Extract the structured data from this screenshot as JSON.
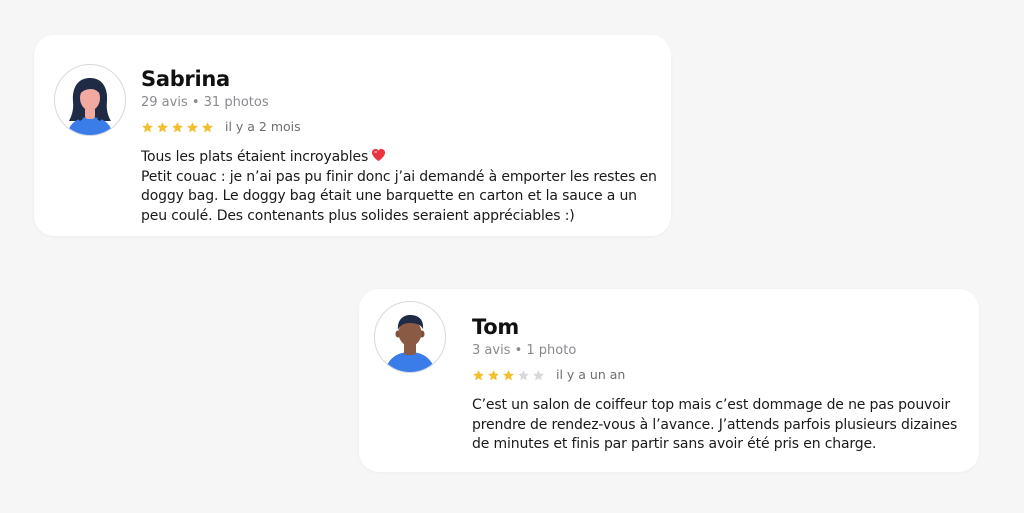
{
  "colors": {
    "star_filled": "#f4bf2e",
    "star_empty": "#d9d9dc",
    "avatar_shirt": "#3b7de8",
    "heart": "#e8353f"
  },
  "reviews": [
    {
      "name": "Sabrina",
      "meta": "29 avis • 31 photos",
      "rating": 5,
      "max_rating": 5,
      "date": "il y a 2 mois",
      "avatar_icon": "woman-avatar-icon",
      "lines": [
        "Tous les plats étaient incroyables",
        "Petit couac : je n’ai pas pu finir donc j’ai demandé à emporter les restes en",
        "doggy bag. Le doggy bag était une barquette en carton et la sauce a un",
        "peu coulé. Des contenants plus solides seraient appréciables :)"
      ]
    },
    {
      "name": "Tom",
      "meta": "3 avis • 1 photo",
      "rating": 3,
      "max_rating": 5,
      "date": "il y a un an",
      "avatar_icon": "man-avatar-icon",
      "lines": [
        "C’est un salon de coiffeur top mais c’est dommage de ne pas pouvoir",
        "prendre de rendez-vous à l’avance. J’attends parfois plusieurs dizaines",
        "de minutes et finis par partir sans avoir été pris en charge."
      ]
    }
  ]
}
